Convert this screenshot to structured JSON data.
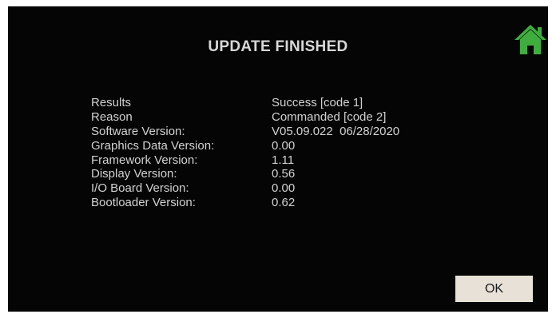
{
  "header": {
    "title": "UPDATE FINISHED",
    "home_icon": "home-icon",
    "home_icon_color": "#3fae3f"
  },
  "info": [
    {
      "label": "Results",
      "value": "Success [code 1]"
    },
    {
      "label": "Reason",
      "value": "Commanded [code 2]"
    },
    {
      "label": "Software Version:",
      "value": "V05.09.022  06/28/2020"
    },
    {
      "label": "Graphics Data Version:",
      "value": "0.00"
    },
    {
      "label": "Framework Version:",
      "value": "1.11"
    },
    {
      "label": "Display Version:",
      "value": "0.56"
    },
    {
      "label": "I/O Board Version:",
      "value": "0.00"
    },
    {
      "label": "Bootloader Version:",
      "value": "0.62"
    }
  ],
  "footer": {
    "ok_label": "OK"
  },
  "colors": {
    "background": "#050505",
    "text": "#d2d2d2",
    "button": "#e7e1d7"
  }
}
